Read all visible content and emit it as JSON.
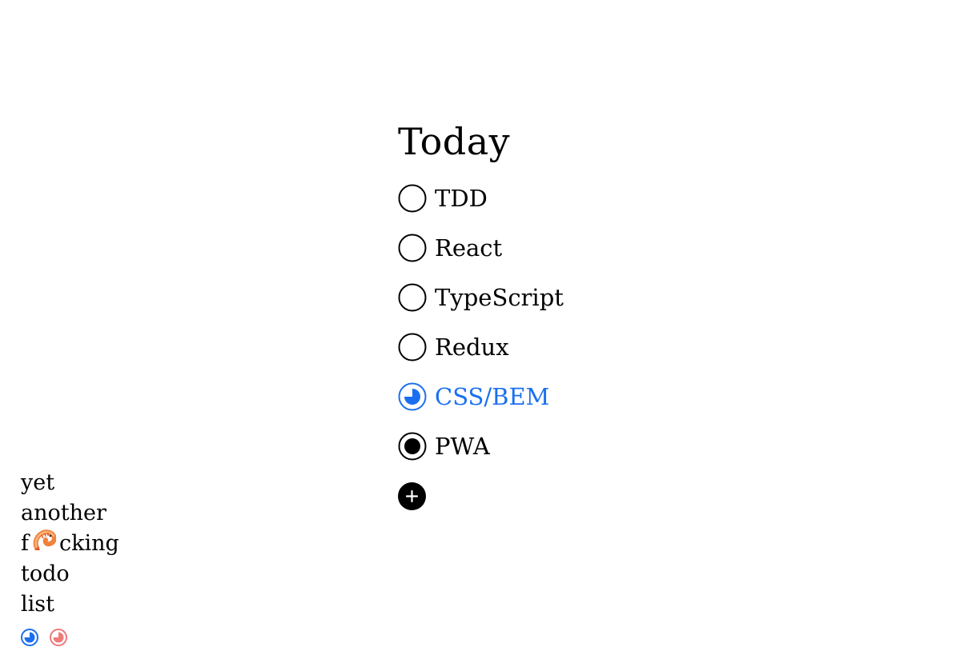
{
  "list": {
    "title": "Today",
    "items": [
      {
        "label": "TDD",
        "state": "empty"
      },
      {
        "label": "React",
        "state": "empty"
      },
      {
        "label": "TypeScript",
        "state": "empty"
      },
      {
        "label": "Redux",
        "state": "empty"
      },
      {
        "label": "CSS/BEM",
        "state": "in-progress"
      },
      {
        "label": "PWA",
        "state": "done"
      }
    ],
    "add_icon": "plus-icon"
  },
  "brand": {
    "line1": "yet",
    "line2": "another",
    "line3_prefix": "f",
    "line3_icon": "shrimp-emoji",
    "line3_suffix": "cking",
    "line4": "todo",
    "line5": "list"
  },
  "theme": {
    "accent": "#1a6ff0",
    "alt_accent": "#f07a7a",
    "swatch_blue_icon": "blue-theme-icon",
    "swatch_red_icon": "red-theme-icon"
  }
}
